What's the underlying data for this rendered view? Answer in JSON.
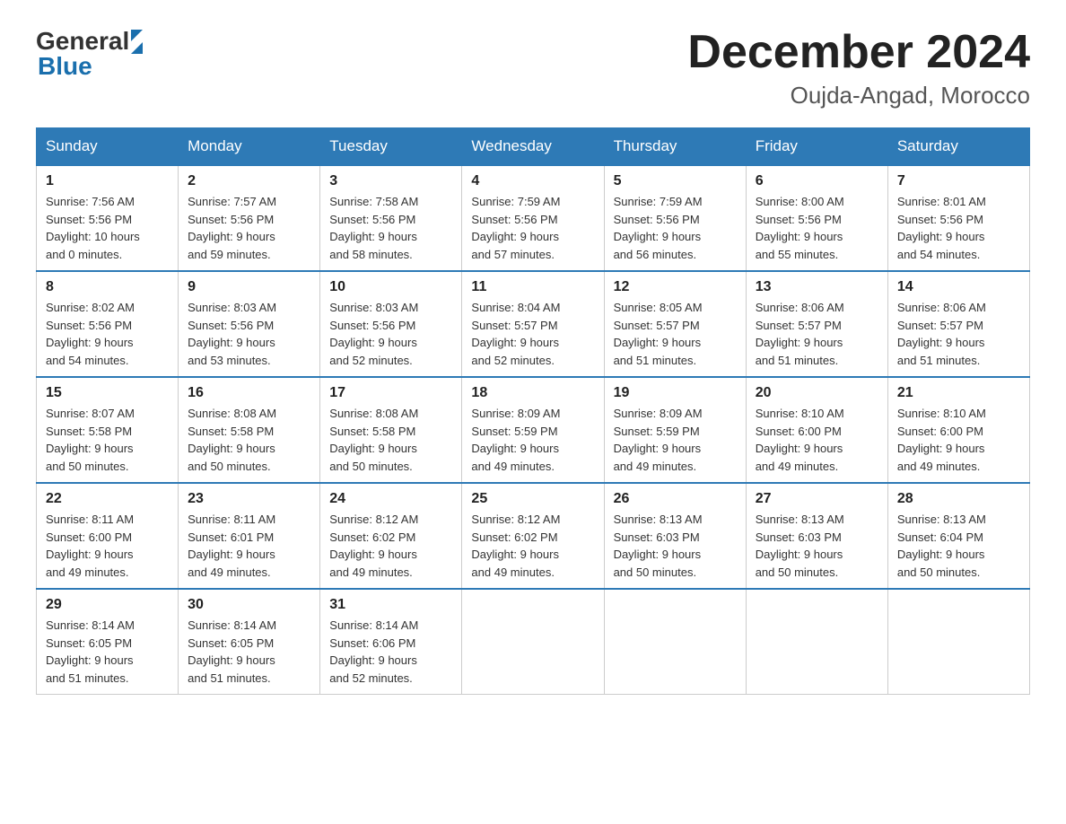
{
  "header": {
    "logo_general": "General",
    "logo_blue": "Blue",
    "month_title": "December 2024",
    "location": "Oujda-Angad, Morocco"
  },
  "days_of_week": [
    "Sunday",
    "Monday",
    "Tuesday",
    "Wednesday",
    "Thursday",
    "Friday",
    "Saturday"
  ],
  "weeks": [
    [
      {
        "day": "1",
        "info": "Sunrise: 7:56 AM\nSunset: 5:56 PM\nDaylight: 10 hours\nand 0 minutes."
      },
      {
        "day": "2",
        "info": "Sunrise: 7:57 AM\nSunset: 5:56 PM\nDaylight: 9 hours\nand 59 minutes."
      },
      {
        "day": "3",
        "info": "Sunrise: 7:58 AM\nSunset: 5:56 PM\nDaylight: 9 hours\nand 58 minutes."
      },
      {
        "day": "4",
        "info": "Sunrise: 7:59 AM\nSunset: 5:56 PM\nDaylight: 9 hours\nand 57 minutes."
      },
      {
        "day": "5",
        "info": "Sunrise: 7:59 AM\nSunset: 5:56 PM\nDaylight: 9 hours\nand 56 minutes."
      },
      {
        "day": "6",
        "info": "Sunrise: 8:00 AM\nSunset: 5:56 PM\nDaylight: 9 hours\nand 55 minutes."
      },
      {
        "day": "7",
        "info": "Sunrise: 8:01 AM\nSunset: 5:56 PM\nDaylight: 9 hours\nand 54 minutes."
      }
    ],
    [
      {
        "day": "8",
        "info": "Sunrise: 8:02 AM\nSunset: 5:56 PM\nDaylight: 9 hours\nand 54 minutes."
      },
      {
        "day": "9",
        "info": "Sunrise: 8:03 AM\nSunset: 5:56 PM\nDaylight: 9 hours\nand 53 minutes."
      },
      {
        "day": "10",
        "info": "Sunrise: 8:03 AM\nSunset: 5:56 PM\nDaylight: 9 hours\nand 52 minutes."
      },
      {
        "day": "11",
        "info": "Sunrise: 8:04 AM\nSunset: 5:57 PM\nDaylight: 9 hours\nand 52 minutes."
      },
      {
        "day": "12",
        "info": "Sunrise: 8:05 AM\nSunset: 5:57 PM\nDaylight: 9 hours\nand 51 minutes."
      },
      {
        "day": "13",
        "info": "Sunrise: 8:06 AM\nSunset: 5:57 PM\nDaylight: 9 hours\nand 51 minutes."
      },
      {
        "day": "14",
        "info": "Sunrise: 8:06 AM\nSunset: 5:57 PM\nDaylight: 9 hours\nand 51 minutes."
      }
    ],
    [
      {
        "day": "15",
        "info": "Sunrise: 8:07 AM\nSunset: 5:58 PM\nDaylight: 9 hours\nand 50 minutes."
      },
      {
        "day": "16",
        "info": "Sunrise: 8:08 AM\nSunset: 5:58 PM\nDaylight: 9 hours\nand 50 minutes."
      },
      {
        "day": "17",
        "info": "Sunrise: 8:08 AM\nSunset: 5:58 PM\nDaylight: 9 hours\nand 50 minutes."
      },
      {
        "day": "18",
        "info": "Sunrise: 8:09 AM\nSunset: 5:59 PM\nDaylight: 9 hours\nand 49 minutes."
      },
      {
        "day": "19",
        "info": "Sunrise: 8:09 AM\nSunset: 5:59 PM\nDaylight: 9 hours\nand 49 minutes."
      },
      {
        "day": "20",
        "info": "Sunrise: 8:10 AM\nSunset: 6:00 PM\nDaylight: 9 hours\nand 49 minutes."
      },
      {
        "day": "21",
        "info": "Sunrise: 8:10 AM\nSunset: 6:00 PM\nDaylight: 9 hours\nand 49 minutes."
      }
    ],
    [
      {
        "day": "22",
        "info": "Sunrise: 8:11 AM\nSunset: 6:00 PM\nDaylight: 9 hours\nand 49 minutes."
      },
      {
        "day": "23",
        "info": "Sunrise: 8:11 AM\nSunset: 6:01 PM\nDaylight: 9 hours\nand 49 minutes."
      },
      {
        "day": "24",
        "info": "Sunrise: 8:12 AM\nSunset: 6:02 PM\nDaylight: 9 hours\nand 49 minutes."
      },
      {
        "day": "25",
        "info": "Sunrise: 8:12 AM\nSunset: 6:02 PM\nDaylight: 9 hours\nand 49 minutes."
      },
      {
        "day": "26",
        "info": "Sunrise: 8:13 AM\nSunset: 6:03 PM\nDaylight: 9 hours\nand 50 minutes."
      },
      {
        "day": "27",
        "info": "Sunrise: 8:13 AM\nSunset: 6:03 PM\nDaylight: 9 hours\nand 50 minutes."
      },
      {
        "day": "28",
        "info": "Sunrise: 8:13 AM\nSunset: 6:04 PM\nDaylight: 9 hours\nand 50 minutes."
      }
    ],
    [
      {
        "day": "29",
        "info": "Sunrise: 8:14 AM\nSunset: 6:05 PM\nDaylight: 9 hours\nand 51 minutes."
      },
      {
        "day": "30",
        "info": "Sunrise: 8:14 AM\nSunset: 6:05 PM\nDaylight: 9 hours\nand 51 minutes."
      },
      {
        "day": "31",
        "info": "Sunrise: 8:14 AM\nSunset: 6:06 PM\nDaylight: 9 hours\nand 52 minutes."
      },
      {
        "day": "",
        "info": ""
      },
      {
        "day": "",
        "info": ""
      },
      {
        "day": "",
        "info": ""
      },
      {
        "day": "",
        "info": ""
      }
    ]
  ]
}
